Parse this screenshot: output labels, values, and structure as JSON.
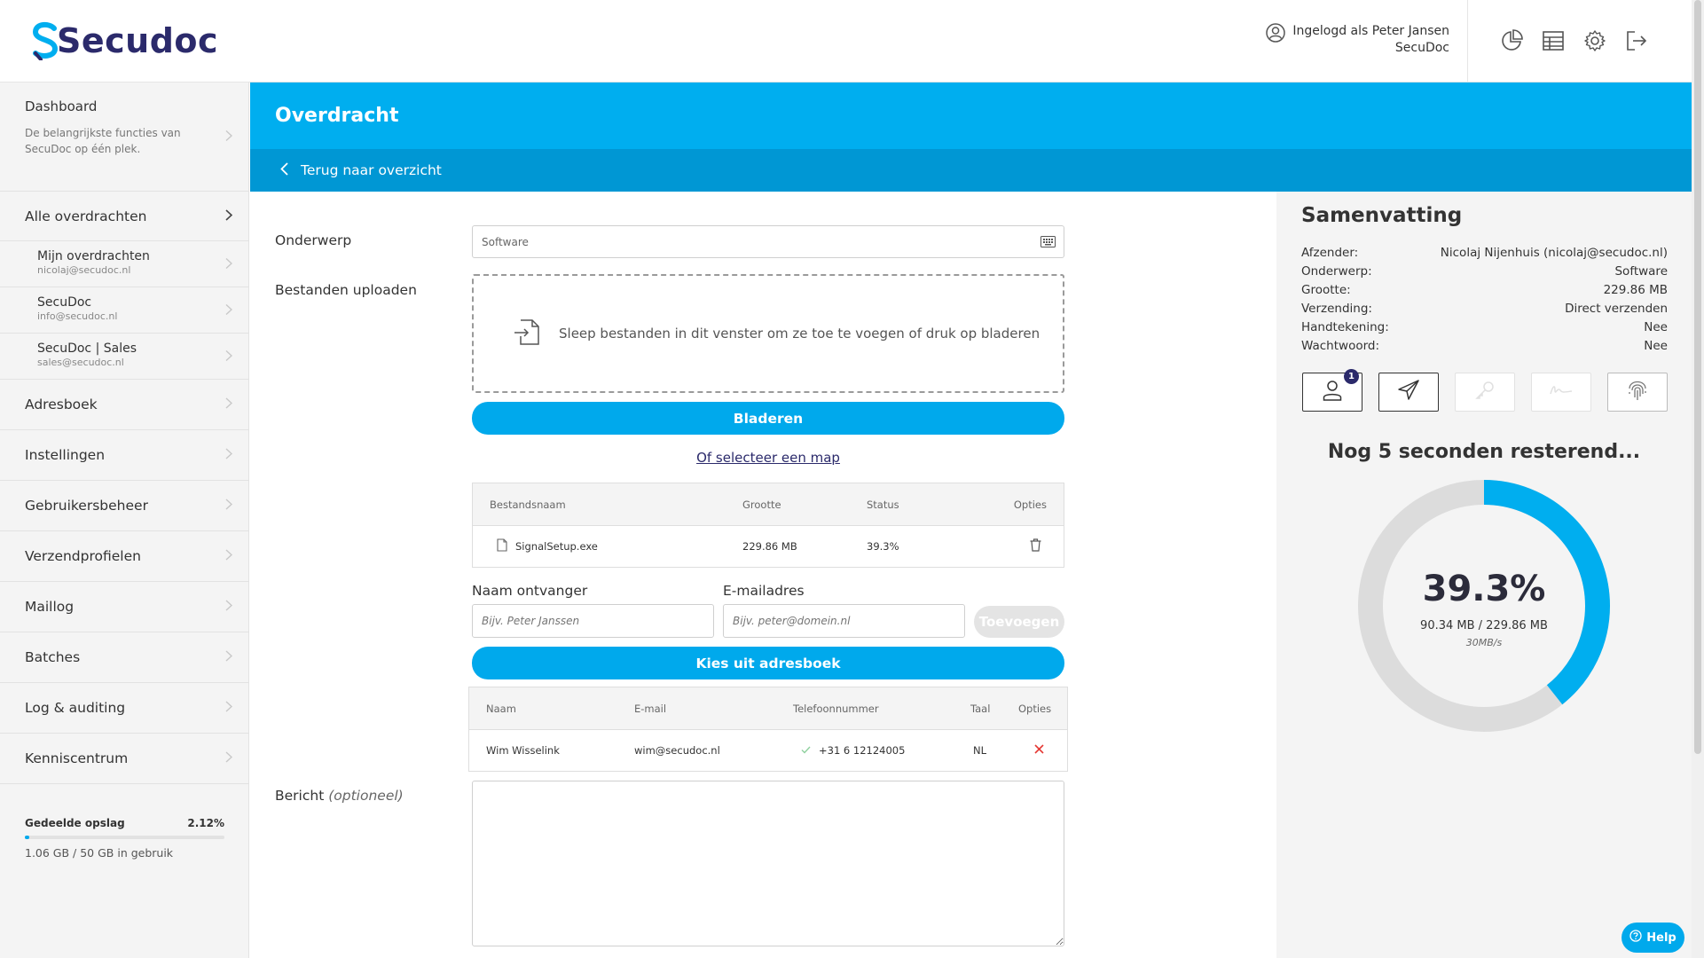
{
  "header": {
    "logo_text": "Secudoc",
    "logged_in_line1": "Ingelogd als Peter Jansen",
    "logged_in_line2": "SecuDoc",
    "icons": [
      "pie-chart-icon",
      "table-icon",
      "gear-icon",
      "logout-icon"
    ]
  },
  "sidebar": {
    "dashboard_title": "Dashboard",
    "dashboard_desc": "De belangrijkste functies van SecuDoc op één plek.",
    "all_transfers": "Alle overdrachten",
    "sub_items": [
      {
        "label": "Mijn overdrachten",
        "email": "nicolaj@secudoc.nl"
      },
      {
        "label": "SecuDoc",
        "email": "info@secudoc.nl"
      },
      {
        "label": "SecuDoc | Sales",
        "email": "sales@secudoc.nl"
      }
    ],
    "items": [
      "Adresboek",
      "Instellingen",
      "Gebruikersbeheer",
      "Verzendprofielen",
      "Maillog",
      "Batches",
      "Log & auditing",
      "Kenniscentrum"
    ],
    "storage_label": "Gedeelde opslag",
    "storage_percent": "2.12%",
    "storage_fraction": 0.0212,
    "storage_usage": "1.06 GB / 50 GB in gebruik"
  },
  "page": {
    "title": "Overdracht",
    "back_label": "Terug naar overzicht"
  },
  "form": {
    "subject_label": "Onderwerp",
    "subject_value": "Software",
    "upload_label": "Bestanden uploaden",
    "dropzone_text": "Sleep bestanden in dit venster om ze toe te voegen of druk op bladeren",
    "browse_button": "Bladeren",
    "select_folder_link": "Of selecteer een map",
    "files_table": {
      "headers": [
        "Bestandsnaam",
        "Grootte",
        "Status",
        "Opties"
      ],
      "rows": [
        {
          "name": "SignalSetup.exe",
          "size": "229.86 MB",
          "status": "39.3%"
        }
      ]
    },
    "recipient_name_label": "Naam ontvanger",
    "recipient_name_placeholder": "Bijv. Peter Janssen",
    "email_label": "E-mailadres",
    "email_placeholder": "Bijv. peter@domein.nl",
    "add_button": "Toevoegen",
    "addressbook_button": "Kies uit adresboek",
    "recipients_table": {
      "headers": [
        "Naam",
        "E-mail",
        "Telefoonnummer",
        "Taal",
        "Opties"
      ],
      "rows": [
        {
          "name": "Wim Wisselink",
          "email": "wim@secudoc.nl",
          "phone": "+31 6 12124005",
          "lang": "NL"
        }
      ]
    },
    "message_label": "Bericht",
    "message_optional": "(optioneel)"
  },
  "summary": {
    "title": "Samenvatting",
    "rows": [
      {
        "k": "Afzender:",
        "v": "Nicolaj Nijenhuis (nicolaj@secudoc.nl)"
      },
      {
        "k": "Onderwerp:",
        "v": "Software"
      },
      {
        "k": "Grootte:",
        "v": "229.86 MB"
      },
      {
        "k": "Verzending:",
        "v": "Direct verzenden"
      },
      {
        "k": "Handtekening:",
        "v": "Nee"
      },
      {
        "k": "Wachtwoord:",
        "v": "Nee"
      }
    ],
    "recipient_badge": "1",
    "remaining": "Nog 5 seconden resterend...",
    "progress_percent": "39.3%",
    "progress_fraction": 0.393,
    "progress_size": "90.34 MB / 229.86 MB",
    "progress_speed": "30MB/s"
  },
  "help_label": "Help",
  "colors": {
    "accent": "#00aeef",
    "accent_dark": "#0097d4",
    "brand": "#2b2a6b",
    "danger": "#e53935"
  }
}
